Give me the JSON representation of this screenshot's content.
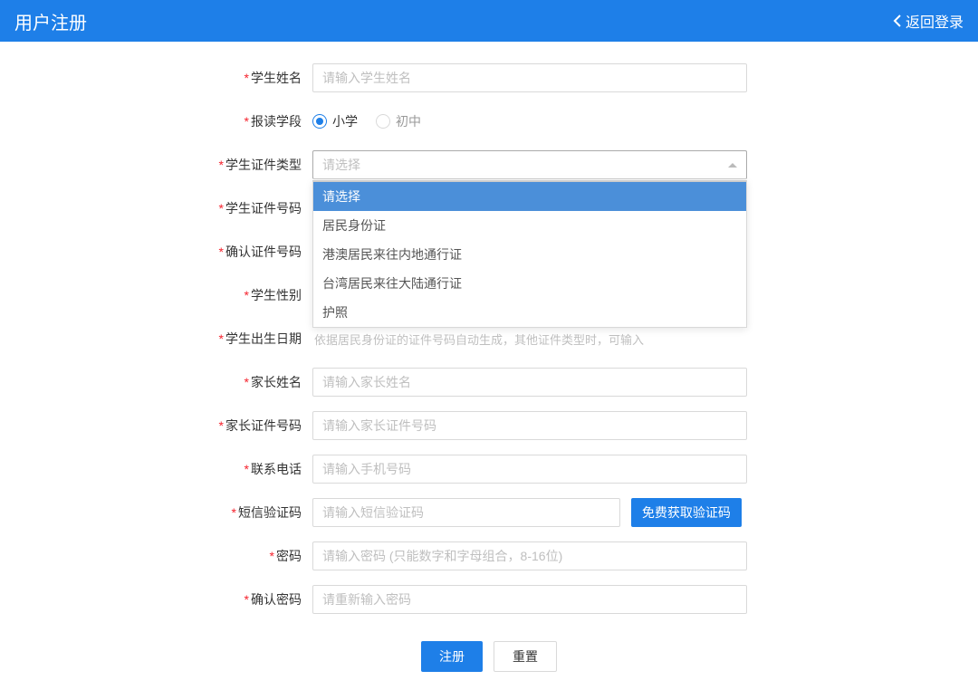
{
  "header": {
    "title": "用户注册",
    "back_label": "返回登录"
  },
  "form": {
    "student_name": {
      "label": "学生姓名",
      "placeholder": "请输入学生姓名"
    },
    "enroll_stage": {
      "label": "报读学段",
      "options": [
        "小学",
        "初中"
      ],
      "selected": "小学"
    },
    "id_type": {
      "label": "学生证件类型",
      "placeholder": "请选择",
      "options": [
        "请选择",
        "居民身份证",
        "港澳居民来往内地通行证",
        "台湾居民来往大陆通行证",
        "护照"
      ],
      "selected_index": 0
    },
    "id_number": {
      "label": "学生证件号码"
    },
    "id_number_confirm": {
      "label": "确认证件号码"
    },
    "gender": {
      "label": "学生性别"
    },
    "birth_date": {
      "label": "学生出生日期",
      "hint_partial": "依据居民身份证的证件号码自动生成，其他证件类型时，可输入"
    },
    "parent_name": {
      "label": "家长姓名",
      "placeholder": "请输入家长姓名"
    },
    "parent_id": {
      "label": "家长证件号码",
      "placeholder": "请输入家长证件号码"
    },
    "phone": {
      "label": "联系电话",
      "placeholder": "请输入手机号码"
    },
    "sms": {
      "label": "短信验证码",
      "placeholder": "请输入短信验证码",
      "button": "免费获取验证码"
    },
    "password": {
      "label": "密码",
      "placeholder": "请输入密码 (只能数字和字母组合，8-16位)"
    },
    "password_confirm": {
      "label": "确认密码",
      "placeholder": "请重新输入密码"
    }
  },
  "buttons": {
    "submit": "注册",
    "reset": "重置"
  }
}
